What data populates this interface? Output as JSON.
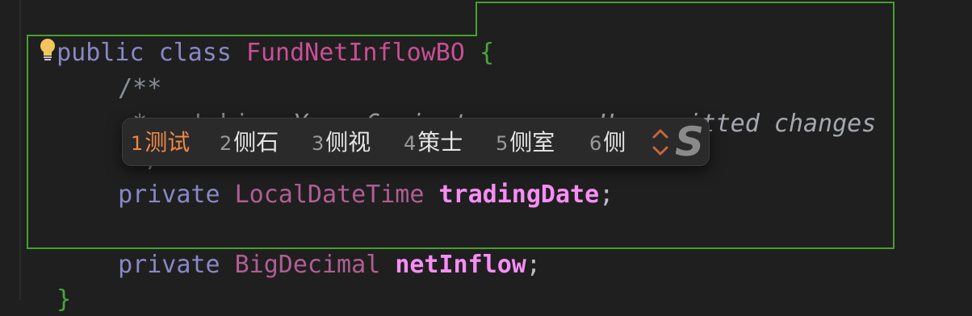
{
  "editor": {
    "line1": {
      "kw_public": "public",
      "kw_class": "class",
      "class_name": "FundNetInflowBO",
      "brace_open": "{"
    },
    "line2": {
      "comment_open": "/**"
    },
    "line3": {
      "star": "*",
      "text": "ce'shi",
      "blame": "You, 6 minutes ago • Uncommitted changes"
    },
    "line4": {
      "star": "*/"
    },
    "line5": {
      "kw_private": "private",
      "type": "LocalDateTime",
      "field": "tradingDate",
      "semi": ";"
    },
    "line7": {
      "kw_private": "private",
      "type": "BigDecimal",
      "field": "netInflow",
      "semi": ";"
    },
    "line8": {
      "brace_close": "}"
    }
  },
  "ime_popup": {
    "candidates": [
      {
        "num": "1",
        "text": "测试",
        "selected": true
      },
      {
        "num": "2",
        "text": "侧石",
        "selected": false
      },
      {
        "num": "3",
        "text": "侧视",
        "selected": false
      },
      {
        "num": "4",
        "text": "策士",
        "selected": false
      },
      {
        "num": "5",
        "text": "侧室",
        "selected": false
      },
      {
        "num": "6",
        "text": "侧",
        "selected": false
      }
    ],
    "logo_text": "S",
    "selected_color": "#f08848",
    "pager_icon": "chevron-up-down-icon"
  },
  "colors": {
    "background": "#1f1f1f",
    "scope_border": "#46a02e",
    "keyword": "#8888c6",
    "class_name": "#c94f96"
  }
}
